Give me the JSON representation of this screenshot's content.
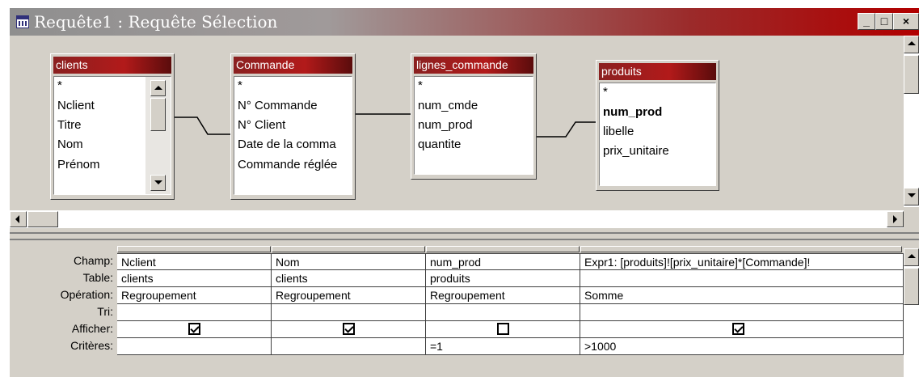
{
  "window": {
    "title": "Requête1 : Requête Sélection",
    "buttons": {
      "minimize": "_",
      "maximize": "□",
      "close": "×"
    }
  },
  "tables": [
    {
      "name": "clients",
      "fields": [
        "*",
        "Nclient",
        "Titre",
        "Nom",
        "Prénom"
      ],
      "scrollable": true
    },
    {
      "name": "Commande",
      "fields": [
        "*",
        "N° Commande",
        "N° Client",
        "Date de la comma",
        "Commande réglée"
      ]
    },
    {
      "name": "lignes_commande",
      "fields": [
        "*",
        "num_cmde",
        "num_prod",
        "quantite"
      ]
    },
    {
      "name": "produits",
      "fields": [
        "*",
        "num_prod",
        "libelle",
        "prix_unitaire"
      ],
      "bold_field": "num_prod"
    }
  ],
  "grid": {
    "row_labels": [
      "Champ:",
      "Table:",
      "Opération:",
      "Tri:",
      "Afficher:",
      "Critères:"
    ],
    "columns": [
      {
        "champ": "Nclient",
        "table": "clients",
        "operation": "Regroupement",
        "tri": "",
        "afficher": true,
        "criteres": ""
      },
      {
        "champ": "Nom",
        "table": "clients",
        "operation": "Regroupement",
        "tri": "",
        "afficher": true,
        "criteres": ""
      },
      {
        "champ": "num_prod",
        "table": "produits",
        "operation": "Regroupement",
        "tri": "",
        "afficher": false,
        "criteres": "=1"
      },
      {
        "champ": "Expr1: [produits]![prix_unitaire]*[Commande]!",
        "table": "",
        "operation": "Somme",
        "tri": "",
        "afficher": true,
        "criteres": ">1000"
      }
    ]
  }
}
